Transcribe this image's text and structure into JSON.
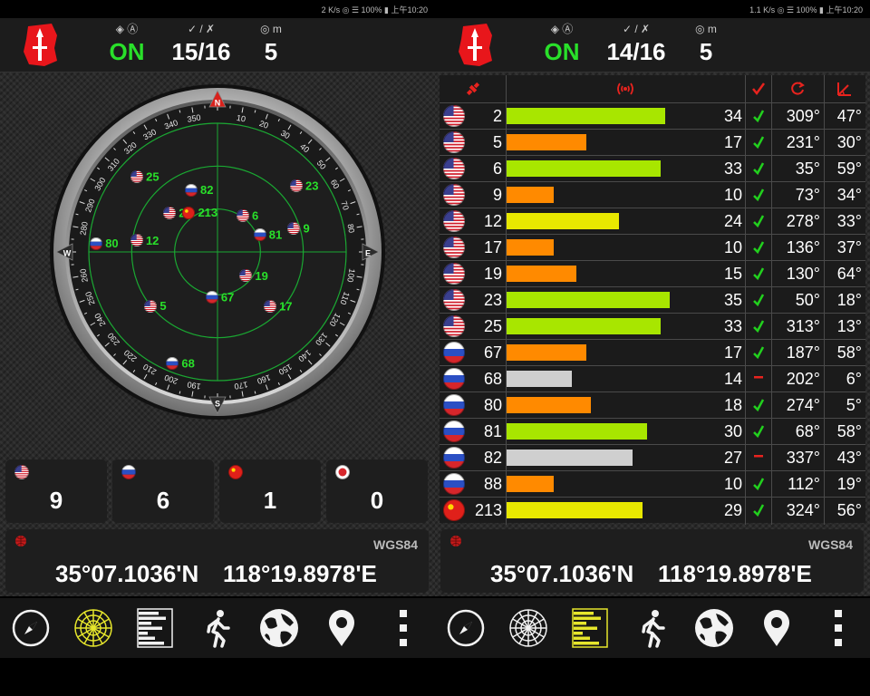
{
  "status_bar": {
    "left": "2 K/s ◎ ☰ 100% ▮ 上午10:20",
    "right": "1.1 K/s ◎ ☰ 100% ▮ 上午10:20"
  },
  "left_panel": {
    "header": {
      "status_icons": "◈ Ⓐ",
      "status": "ON",
      "sats_icons": "✓ / ✗",
      "sats": "15/16",
      "accuracy_icons": "◎ m",
      "accuracy": "5"
    },
    "radar": {
      "colors": {
        "ring": "#1aa832",
        "sat_label": "#29e02a"
      },
      "cardinals": [
        "N",
        "E",
        "S",
        "W"
      ],
      "degree_labels": [
        "10",
        "20",
        "30",
        "40",
        "50",
        "60",
        "70",
        "80",
        "100",
        "110",
        "120",
        "130",
        "140",
        "150",
        "160",
        "170",
        "190",
        "200",
        "210",
        "220",
        "230",
        "240",
        "250",
        "260",
        "280",
        "290",
        "300",
        "310",
        "320",
        "330",
        "340",
        "350"
      ],
      "satellites": [
        {
          "id": "25",
          "flag": "us",
          "azimuth": 313,
          "elevation": 13
        },
        {
          "id": "82",
          "flag": "ru",
          "azimuth": 337,
          "elevation": 43
        },
        {
          "id": "23",
          "flag": "us",
          "azimuth": 50,
          "elevation": 18
        },
        {
          "id": "2",
          "flag": "us",
          "azimuth": 309,
          "elevation": 47
        },
        {
          "id": "213",
          "flag": "cn",
          "azimuth": 324,
          "elevation": 56
        },
        {
          "id": "6",
          "flag": "us",
          "azimuth": 35,
          "elevation": 59
        },
        {
          "id": "80",
          "flag": "ru",
          "azimuth": 274,
          "elevation": 5
        },
        {
          "id": "12",
          "flag": "us",
          "azimuth": 278,
          "elevation": 33
        },
        {
          "id": "81",
          "flag": "ru",
          "azimuth": 68,
          "elevation": 58
        },
        {
          "id": "9",
          "flag": "us",
          "azimuth": 73,
          "elevation": 34
        },
        {
          "id": "19",
          "flag": "us",
          "azimuth": 130,
          "elevation": 64
        },
        {
          "id": "67",
          "flag": "ru",
          "azimuth": 187,
          "elevation": 58
        },
        {
          "id": "5",
          "flag": "us",
          "azimuth": 231,
          "elevation": 30
        },
        {
          "id": "17",
          "flag": "us",
          "azimuth": 136,
          "elevation": 37
        },
        {
          "id": "68",
          "flag": "ru",
          "azimuth": 202,
          "elevation": 6
        }
      ]
    },
    "constellation_counts": [
      {
        "flag": "us",
        "count": "9"
      },
      {
        "flag": "ru",
        "count": "6"
      },
      {
        "flag": "cn",
        "count": "1"
      },
      {
        "flag": "jp",
        "count": "0"
      }
    ],
    "coords": {
      "datum": "WGS84",
      "lat": "35°07.1036'N",
      "lon": "118°19.8978'E"
    }
  },
  "right_panel": {
    "header": {
      "status_icons": "◈ Ⓐ",
      "status": "ON",
      "sats_icons": "✓ / ✗",
      "sats": "14/16",
      "accuracy_icons": "◎ m",
      "accuracy": "5"
    },
    "table": {
      "colors": {
        "green": "#a8e600",
        "yellow": "#e8e800",
        "orange": "#ff8a00",
        "gray": "#cfcfcf",
        "check": "#22d01e",
        "dash": "#e8231e",
        "header_icon": "#e8231e"
      },
      "header_icons": [
        "satellite-icon",
        "signal-icon",
        "used-check-icon",
        "azimuth-icon",
        "elevation-icon"
      ],
      "signal_max": 45,
      "rows": [
        {
          "flag": "us",
          "prn": "2",
          "snr": "34",
          "band": "green",
          "used": true,
          "azimuth": "309°",
          "elevation": "47°"
        },
        {
          "flag": "us",
          "prn": "5",
          "snr": "17",
          "band": "orange",
          "used": true,
          "azimuth": "231°",
          "elevation": "30°"
        },
        {
          "flag": "us",
          "prn": "6",
          "snr": "33",
          "band": "green",
          "used": true,
          "azimuth": "35°",
          "elevation": "59°"
        },
        {
          "flag": "us",
          "prn": "9",
          "snr": "10",
          "band": "orange",
          "used": true,
          "azimuth": "73°",
          "elevation": "34°"
        },
        {
          "flag": "us",
          "prn": "12",
          "snr": "24",
          "band": "yellow",
          "used": true,
          "azimuth": "278°",
          "elevation": "33°"
        },
        {
          "flag": "us",
          "prn": "17",
          "snr": "10",
          "band": "orange",
          "used": true,
          "azimuth": "136°",
          "elevation": "37°"
        },
        {
          "flag": "us",
          "prn": "19",
          "snr": "15",
          "band": "orange",
          "used": true,
          "azimuth": "130°",
          "elevation": "64°"
        },
        {
          "flag": "us",
          "prn": "23",
          "snr": "35",
          "band": "green",
          "used": true,
          "azimuth": "50°",
          "elevation": "18°"
        },
        {
          "flag": "us",
          "prn": "25",
          "snr": "33",
          "band": "green",
          "used": true,
          "azimuth": "313°",
          "elevation": "13°"
        },
        {
          "flag": "ru",
          "prn": "67",
          "snr": "17",
          "band": "orange",
          "used": true,
          "azimuth": "187°",
          "elevation": "58°"
        },
        {
          "flag": "ru",
          "prn": "68",
          "snr": "14",
          "band": "gray",
          "used": false,
          "azimuth": "202°",
          "elevation": "6°"
        },
        {
          "flag": "ru",
          "prn": "80",
          "snr": "18",
          "band": "orange",
          "used": true,
          "azimuth": "274°",
          "elevation": "5°"
        },
        {
          "flag": "ru",
          "prn": "81",
          "snr": "30",
          "band": "green",
          "used": true,
          "azimuth": "68°",
          "elevation": "58°"
        },
        {
          "flag": "ru",
          "prn": "82",
          "snr": "27",
          "band": "gray",
          "used": false,
          "azimuth": "337°",
          "elevation": "43°"
        },
        {
          "flag": "ru",
          "prn": "88",
          "snr": "10",
          "band": "orange",
          "used": true,
          "azimuth": "112°",
          "elevation": "19°"
        },
        {
          "flag": "cn",
          "prn": "213",
          "snr": "29",
          "band": "yellow",
          "used": true,
          "azimuth": "324°",
          "elevation": "56°"
        }
      ]
    },
    "coords": {
      "datum": "WGS84",
      "lat": "35°07.1036'N",
      "lon": "118°19.8978'E"
    }
  },
  "nav": {
    "items": [
      "compass-icon",
      "radar-view-icon",
      "signal-bars-icon",
      "walk-icon",
      "globe-icon",
      "location-pin-icon",
      "more-icon"
    ],
    "left_active": 1,
    "right_active": 2,
    "active_color": "#e6e62c"
  }
}
